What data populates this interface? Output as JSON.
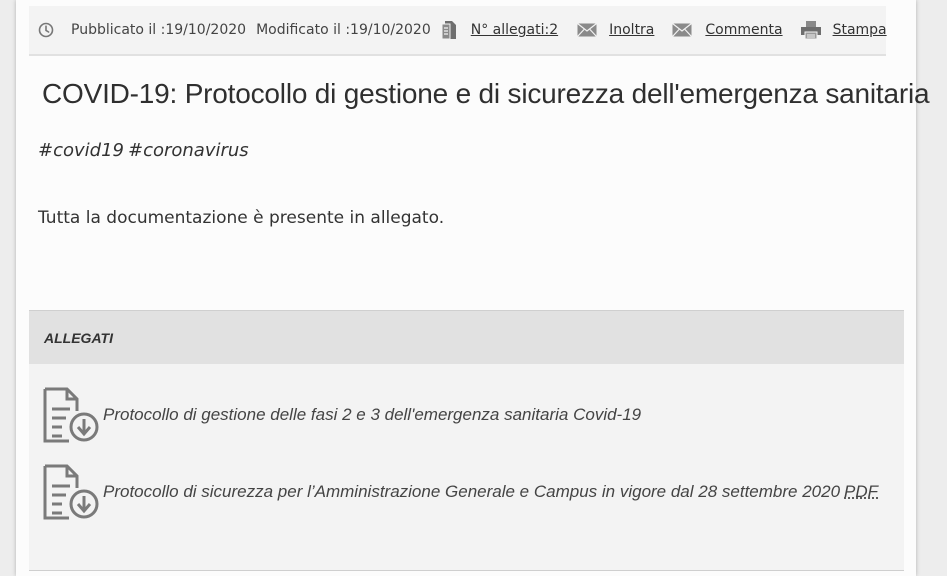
{
  "meta": {
    "published_label": "Pubblicato il :",
    "published_date": "19/10/2020",
    "modified_label": "Modificato il :",
    "modified_date": "19/10/2020",
    "attachments_link": "N° allegati:2",
    "forward_link": "Inoltra",
    "comment_link": "Commenta",
    "print_link": "Stampa",
    "icons": [
      "clock-icon",
      "attachment-doc-icon",
      "envelope-icon",
      "envelope-icon",
      "printer-icon"
    ]
  },
  "article": {
    "title": "COVID-19: Protocollo di gestione e di sicurezza dell'emergenza sanitaria",
    "tags": [
      "#covid19",
      "#coronavirus"
    ],
    "body": "Tutta la documentazione è presente in allegato."
  },
  "attachments": {
    "header": "ALLEGATI",
    "items": [
      {
        "label": "Protocollo di gestione delle fasi 2 e 3 dell'emergenza sanitaria Covid-19",
        "format": ""
      },
      {
        "label": "Protocollo di sicurezza per l’Amministrazione Generale e Campus in vigore dal 28 settembre 2020",
        "format": "PDF"
      }
    ]
  },
  "colors": {
    "meta_bar": "#f3f3f3",
    "attach_header": "#e1e1e1",
    "attach_body": "#f3f3f3",
    "icon_gray": "#7a7a7a"
  }
}
